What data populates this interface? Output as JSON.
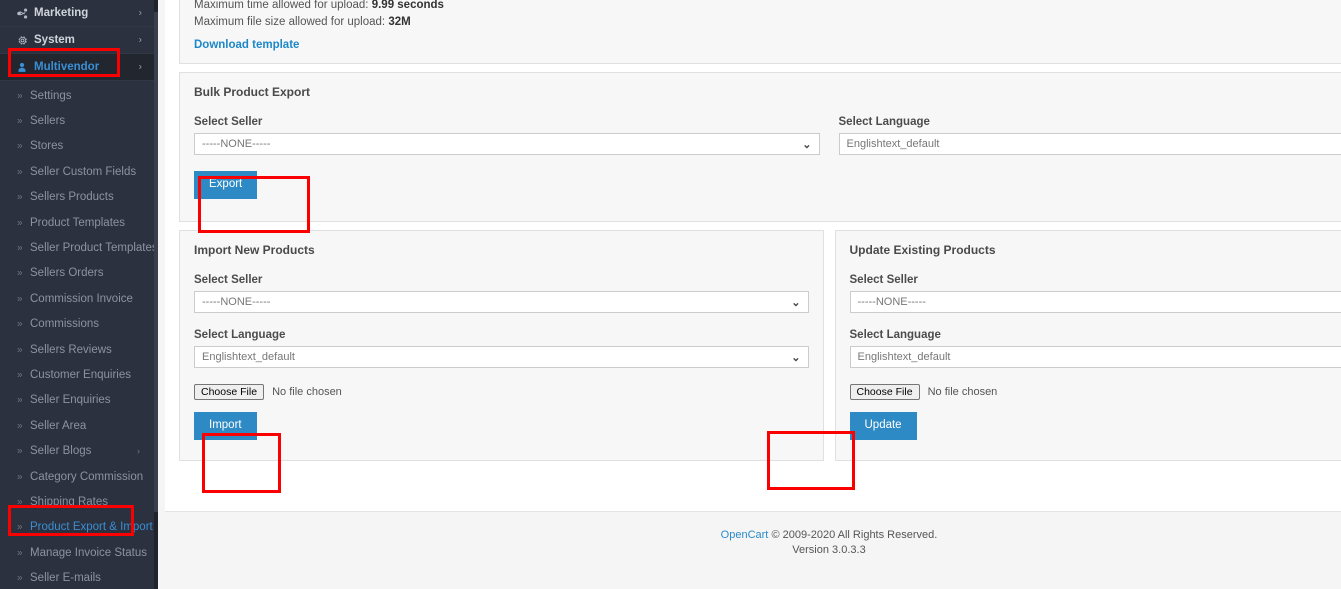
{
  "sidebar": {
    "top_items": [
      {
        "label": "Marketing",
        "icon": "share-icon",
        "caret": "›",
        "active": false
      },
      {
        "label": "System",
        "icon": "gear-icon",
        "caret": "›",
        "active": false
      },
      {
        "label": "Multivendor",
        "icon": "user-icon",
        "caret": "›",
        "active": true
      }
    ],
    "sub_items": [
      {
        "label": "Settings",
        "bullet": "»",
        "caret": "",
        "highlight": false
      },
      {
        "label": "Sellers",
        "bullet": "»",
        "caret": "",
        "highlight": false
      },
      {
        "label": "Stores",
        "bullet": "»",
        "caret": "",
        "highlight": false
      },
      {
        "label": "Seller Custom Fields",
        "bullet": "»",
        "caret": "",
        "highlight": false
      },
      {
        "label": "Sellers Products",
        "bullet": "»",
        "caret": "",
        "highlight": false
      },
      {
        "label": "Product Templates",
        "bullet": "»",
        "caret": "",
        "highlight": false
      },
      {
        "label": "Seller Product Templates",
        "bullet": "»",
        "caret": "",
        "highlight": false
      },
      {
        "label": "Sellers Orders",
        "bullet": "»",
        "caret": "",
        "highlight": false
      },
      {
        "label": "Commission Invoice",
        "bullet": "»",
        "caret": "",
        "highlight": false
      },
      {
        "label": "Commissions",
        "bullet": "»",
        "caret": "",
        "highlight": false
      },
      {
        "label": "Sellers Reviews",
        "bullet": "»",
        "caret": "",
        "highlight": false
      },
      {
        "label": "Customer Enquiries",
        "bullet": "»",
        "caret": "",
        "highlight": false
      },
      {
        "label": "Seller Enquiries",
        "bullet": "»",
        "caret": "",
        "highlight": false
      },
      {
        "label": "Seller Area",
        "bullet": "»",
        "caret": "",
        "highlight": false
      },
      {
        "label": "Seller Blogs",
        "bullet": "»",
        "caret": "›",
        "highlight": false
      },
      {
        "label": "Category Commission",
        "bullet": "»",
        "caret": "",
        "highlight": false
      },
      {
        "label": "Shipping Rates",
        "bullet": "»",
        "caret": "",
        "highlight": false
      },
      {
        "label": "Product Export & Import",
        "bullet": "»",
        "caret": "",
        "highlight": true
      },
      {
        "label": "Manage Invoice Status",
        "bullet": "»",
        "caret": "",
        "highlight": false
      },
      {
        "label": "Seller E-mails",
        "bullet": "»",
        "caret": "",
        "highlight": false
      }
    ]
  },
  "upload_info": {
    "max_time_label": "Maximum time allowed for upload:",
    "max_time_value": "9.99  seconds",
    "max_size_label": "Maximum file size allowed for upload:",
    "max_size_value": "32M",
    "download_template": "Download template"
  },
  "bulk_export": {
    "title": "Bulk Product Export",
    "seller_label": "Select Seller",
    "seller_value": "-----NONE-----",
    "language_label": "Select Language",
    "language_value": "Englishtext_default",
    "button": "Export"
  },
  "import_new": {
    "title": "Import New Products",
    "seller_label": "Select Seller",
    "seller_value": "-----NONE-----",
    "language_label": "Select Language",
    "language_value": "Englishtext_default",
    "choose_file": "Choose File",
    "no_file": "No file chosen",
    "button": "Import"
  },
  "update_existing": {
    "title": "Update Existing Products",
    "seller_label": "Select Seller",
    "seller_value": "-----NONE-----",
    "language_label": "Select Language",
    "language_value": "Englishtext_default",
    "choose_file": "Choose File",
    "no_file": "No file chosen",
    "button": "Update"
  },
  "footer": {
    "brand": "OpenCart",
    "copyright": "© 2009-2020 All Rights Reserved.",
    "version": "Version 3.0.3.3"
  },
  "colors": {
    "sidebar_bg": "#2b313e",
    "accent_blue": "#2e8ac4",
    "link_blue": "#1d88c9",
    "highlight_red": "#fb0000"
  },
  "chevron": "⌄"
}
